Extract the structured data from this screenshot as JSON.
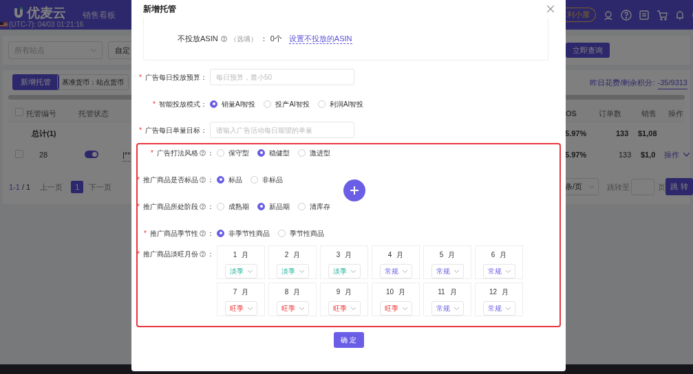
{
  "header": {
    "logo_text": "优麦云",
    "nav": [
      "销售看板"
    ],
    "timezone": "(UTC-7): 04/03 01:21:16",
    "promo": "利小屋"
  },
  "filters": {
    "site_select": "所有站点",
    "custom": "自定",
    "query_button": "立即查询"
  },
  "toolbar": {
    "add_button": "新增托管",
    "currency_button": "基准货币：站点货币",
    "spend_label": "昨日花费/剩余积分:",
    "spend_value": "-35/9313"
  },
  "table": {
    "header_checked": false,
    "columns": [
      "托管编号",
      "托管状态",
      "OS",
      "订单数",
      "销售",
      "操作"
    ],
    "total_row": {
      "label": "总计(1)",
      "acos": "5.97%",
      "orders": "133",
      "sales": "$1,08"
    },
    "rows": [
      {
        "checked": false,
        "id": "28",
        "on": true,
        "name": "|**",
        "acos": "5.97%",
        "orders": "133",
        "sales": "$1,0",
        "action": "操作"
      }
    ]
  },
  "pagination": {
    "range": "1-1",
    "total": "/ 1",
    "prev": "上一页",
    "page": "1",
    "next": "下一页",
    "page_size": "条/页",
    "jump_label": "跳转至",
    "page_unit": "页",
    "jump_button": "跳 转"
  },
  "modal": {
    "title": "新增托管",
    "asin": {
      "label": "不投放ASIN",
      "optional": "（选填）",
      "colon": "：",
      "count": "0个",
      "link": "设置不投放的ASIN"
    },
    "required_mark": "*",
    "budget": {
      "label": "广告每日投放预算：",
      "placeholder": "每日预算，最小50"
    },
    "mode": {
      "label": "智能投放模式：",
      "options": [
        {
          "label": "销量AI智投",
          "selected": true
        },
        {
          "label": "投产AI智投",
          "selected": false
        },
        {
          "label": "利润AI智投",
          "selected": false
        }
      ]
    },
    "target": {
      "label": "广告每日单量目标：",
      "placeholder": "请输入广告活动每日期望的单量"
    },
    "groups": [
      {
        "label": "广告打法风格",
        "options": [
          {
            "label": "保守型",
            "selected": false
          },
          {
            "label": "稳健型",
            "selected": true
          },
          {
            "label": "激进型",
            "selected": false
          }
        ]
      },
      {
        "label": "推广商品是否标品",
        "options": [
          {
            "label": "标品",
            "selected": true
          },
          {
            "label": "非标品",
            "selected": false
          }
        ]
      },
      {
        "label": "推广商品所处阶段",
        "options": [
          {
            "label": "成熟期",
            "selected": false
          },
          {
            "label": "新品期",
            "selected": true
          },
          {
            "label": "清库存",
            "selected": false
          }
        ]
      },
      {
        "label": "推广商品季节性",
        "options": [
          {
            "label": "非季节性商品",
            "selected": true
          },
          {
            "label": "季节性商品",
            "selected": false
          }
        ]
      }
    ],
    "months_label": "推广商品淡旺月份",
    "months": [
      {
        "month": "1",
        "unit": "月",
        "value": "淡季",
        "kind": "low"
      },
      {
        "month": "2",
        "unit": "月",
        "value": "淡季",
        "kind": "low"
      },
      {
        "month": "3",
        "unit": "月",
        "value": "淡季",
        "kind": "low"
      },
      {
        "month": "4",
        "unit": "月",
        "value": "常规",
        "kind": "normal"
      },
      {
        "month": "5",
        "unit": "月",
        "value": "常规",
        "kind": "normal"
      },
      {
        "month": "6",
        "unit": "月",
        "value": "常规",
        "kind": "normal"
      },
      {
        "month": "7",
        "unit": "月",
        "value": "旺季",
        "kind": "peak"
      },
      {
        "month": "8",
        "unit": "月",
        "value": "旺季",
        "kind": "peak"
      },
      {
        "month": "9",
        "unit": "月",
        "value": "旺季",
        "kind": "peak"
      },
      {
        "month": "10",
        "unit": "月",
        "value": "旺季",
        "kind": "peak"
      },
      {
        "month": "11",
        "unit": "月",
        "value": "常规",
        "kind": "normal"
      },
      {
        "month": "12",
        "unit": "月",
        "value": "常规",
        "kind": "normal"
      }
    ],
    "confirm": "确 定"
  }
}
